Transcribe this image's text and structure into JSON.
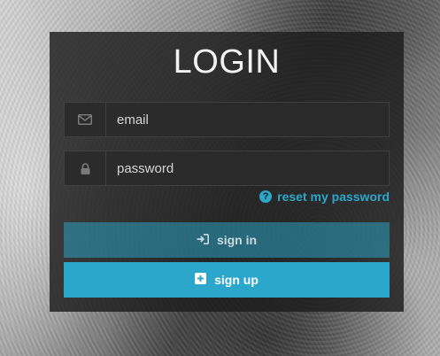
{
  "login": {
    "title": "LOGIN",
    "email": {
      "placeholder": "email",
      "icon": "envelope-icon"
    },
    "password": {
      "placeholder": "password",
      "icon": "lock-icon"
    },
    "reset_link": {
      "label": "reset my password",
      "icon": "question-circle-icon"
    },
    "signin": {
      "label": "sign in",
      "icon": "sign-in-icon"
    },
    "signup": {
      "label": "sign up",
      "icon": "plus-square-icon"
    }
  },
  "colors": {
    "accent": "#2aa7cb",
    "panel": "#1c1c1c"
  }
}
